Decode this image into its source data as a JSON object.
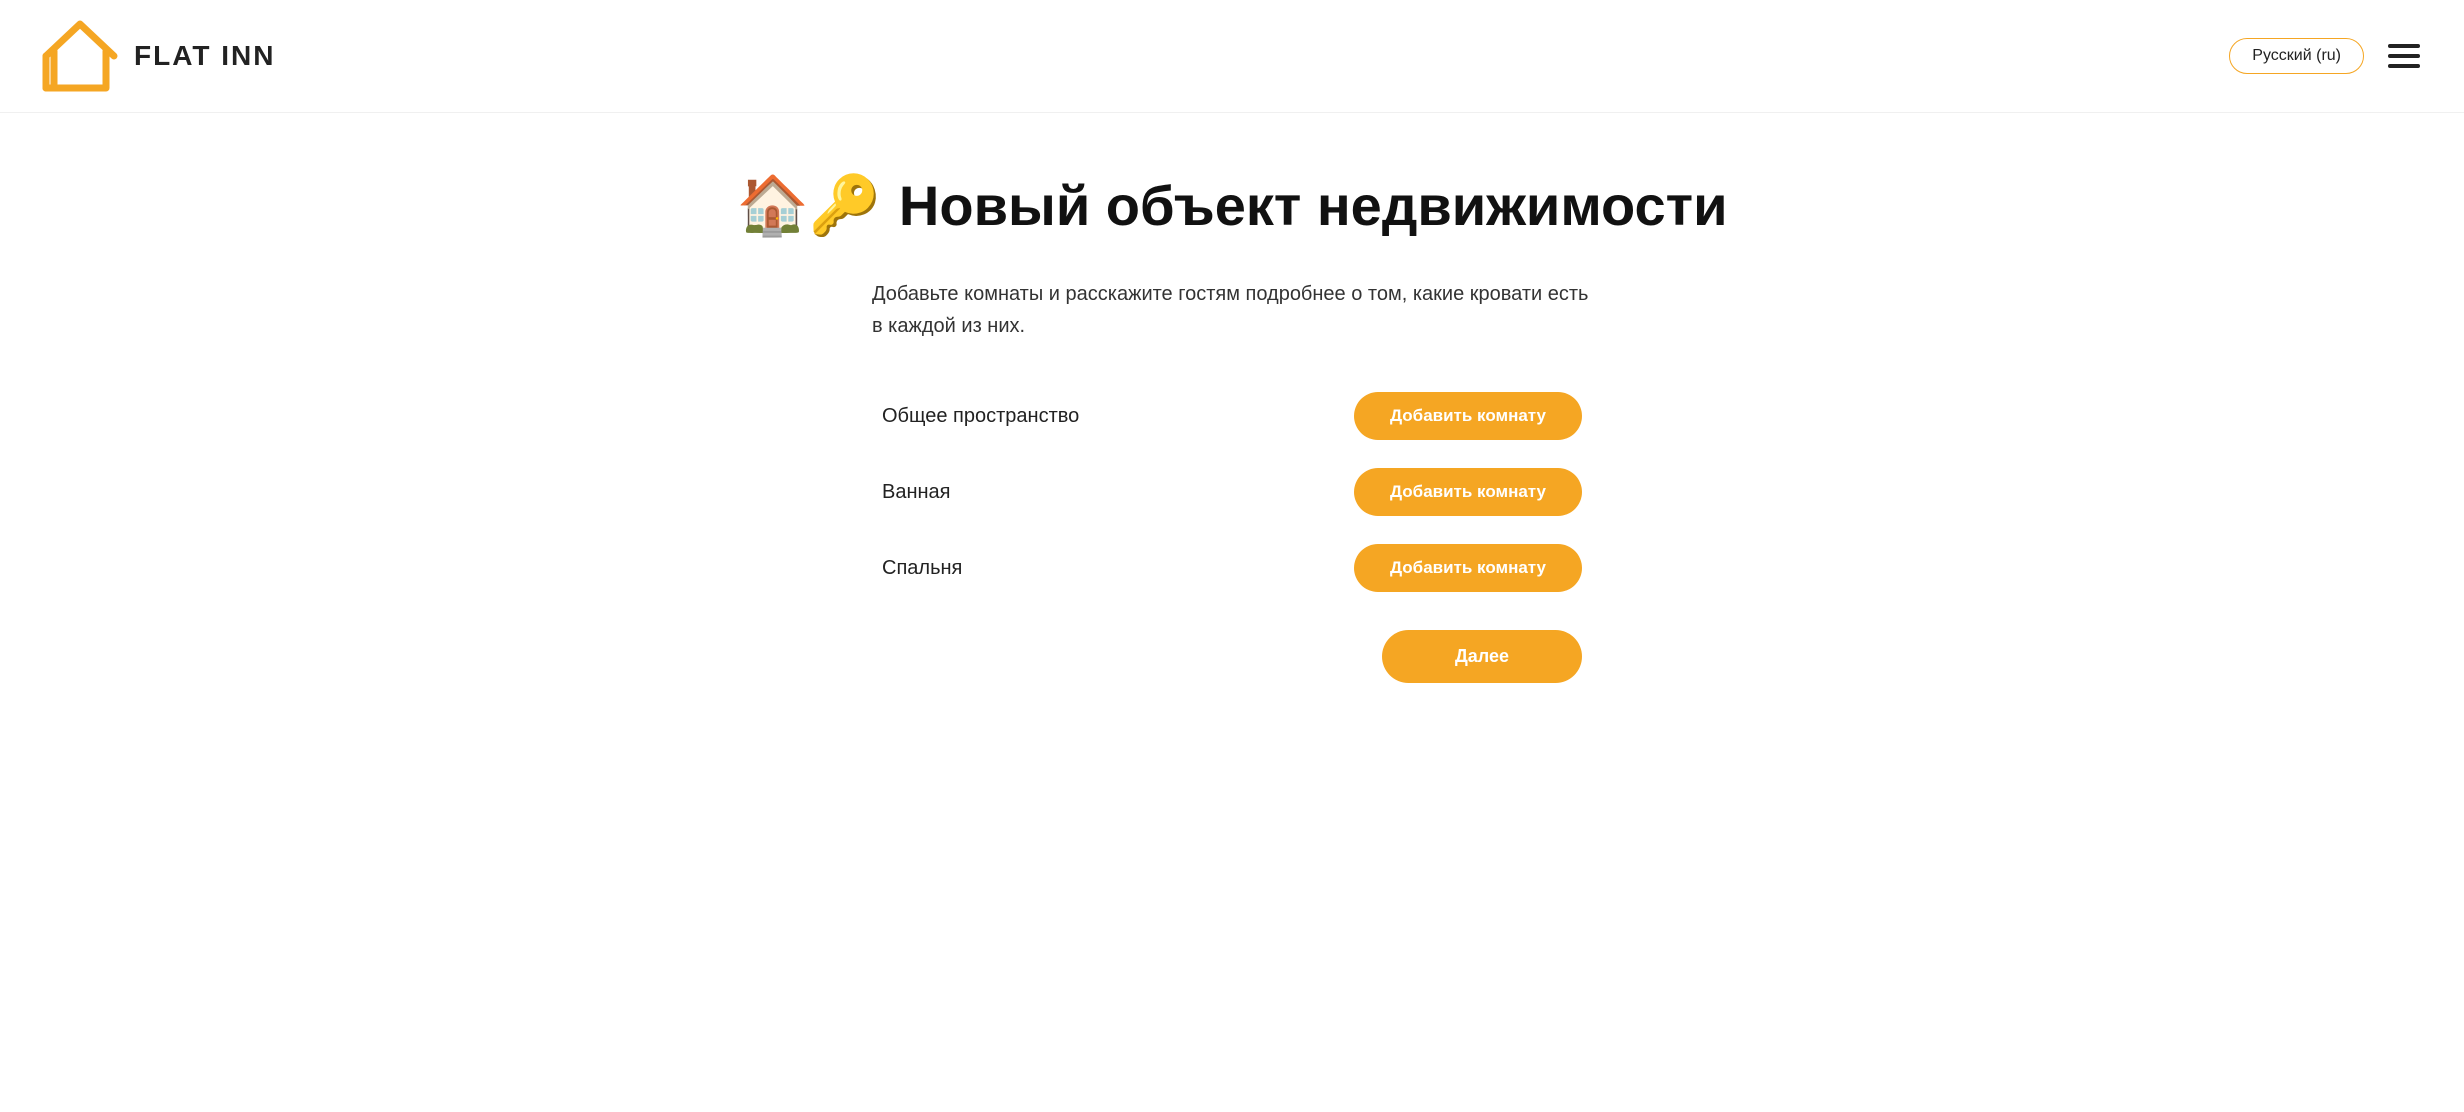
{
  "header": {
    "logo_text": "FLAT INN",
    "language_btn": "Русский (ru)",
    "hamburger_label": "Menu"
  },
  "page": {
    "title": "Новый объект недвижимости",
    "description": "Добавьте комнаты и расскажите гостям подробнее о том, какие кровати есть в каждой из них.",
    "rooms": [
      {
        "label": "Общее пространство",
        "btn_label": "Добавить комнату"
      },
      {
        "label": "Ванная",
        "btn_label": "Добавить комнату"
      },
      {
        "label": "Спальня",
        "btn_label": "Добавить комнату"
      }
    ],
    "next_btn": "Далее"
  }
}
